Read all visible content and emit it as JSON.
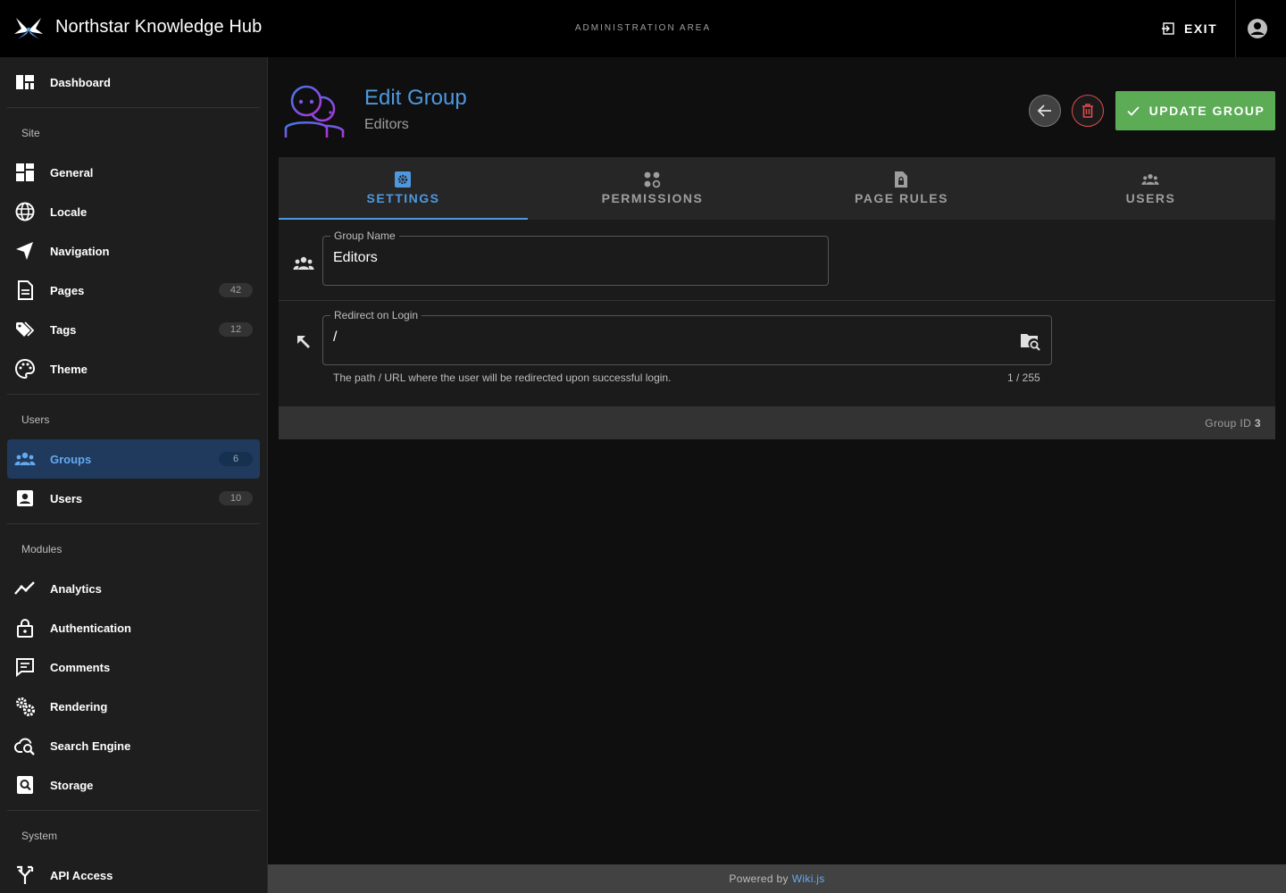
{
  "topbar": {
    "app_title": "Northstar Knowledge Hub",
    "area_label": "ADMINISTRATION AREA",
    "exit_label": "EXIT"
  },
  "sidebar": {
    "dashboard": "Dashboard",
    "sections": {
      "site": "Site",
      "users": "Users",
      "modules": "Modules",
      "system": "System"
    },
    "site_items": [
      {
        "label": "General",
        "icon": "view-dashboard-icon"
      },
      {
        "label": "Locale",
        "icon": "globe-icon"
      },
      {
        "label": "Navigation",
        "icon": "navigation-arrow-icon"
      },
      {
        "label": "Pages",
        "icon": "file-document-icon",
        "badge": "42"
      },
      {
        "label": "Tags",
        "icon": "tags-icon",
        "badge": "12"
      },
      {
        "label": "Theme",
        "icon": "palette-icon"
      }
    ],
    "users_items": [
      {
        "label": "Groups",
        "icon": "account-group-icon",
        "badge": "6",
        "active": true
      },
      {
        "label": "Users",
        "icon": "account-box-icon",
        "badge": "10"
      }
    ],
    "modules_items": [
      {
        "label": "Analytics",
        "icon": "chart-line-icon"
      },
      {
        "label": "Authentication",
        "icon": "lock-icon"
      },
      {
        "label": "Comments",
        "icon": "comment-icon"
      },
      {
        "label": "Rendering",
        "icon": "cogs-icon"
      },
      {
        "label": "Search Engine",
        "icon": "cloud-search-icon"
      },
      {
        "label": "Storage",
        "icon": "storage-icon"
      }
    ],
    "system_items": [
      {
        "label": "API Access",
        "icon": "api-icon"
      }
    ]
  },
  "header": {
    "title": "Edit Group",
    "subtitle": "Editors",
    "update_label": "UPDATE GROUP"
  },
  "tabs": [
    {
      "label": "SETTINGS",
      "icon": "cog-box-icon",
      "active": true
    },
    {
      "label": "PERMISSIONS",
      "icon": "permissions-icon"
    },
    {
      "label": "PAGE RULES",
      "icon": "file-lock-icon"
    },
    {
      "label": "USERS",
      "icon": "account-group-icon"
    }
  ],
  "form": {
    "group_name_label": "Group Name",
    "group_name_value": "Editors",
    "redirect_label": "Redirect on Login",
    "redirect_value": "/",
    "redirect_hint": "The path / URL where the user will be redirected upon successful login.",
    "redirect_counter": "1 / 255"
  },
  "card_footer": {
    "group_id_label": "Group ID",
    "group_id_value": "3"
  },
  "footer": {
    "powered_by": "Powered by",
    "link": "Wiki.js"
  },
  "colors": {
    "accent": "#4f98e0",
    "success": "#5cab55",
    "danger": "#e04d4d"
  }
}
